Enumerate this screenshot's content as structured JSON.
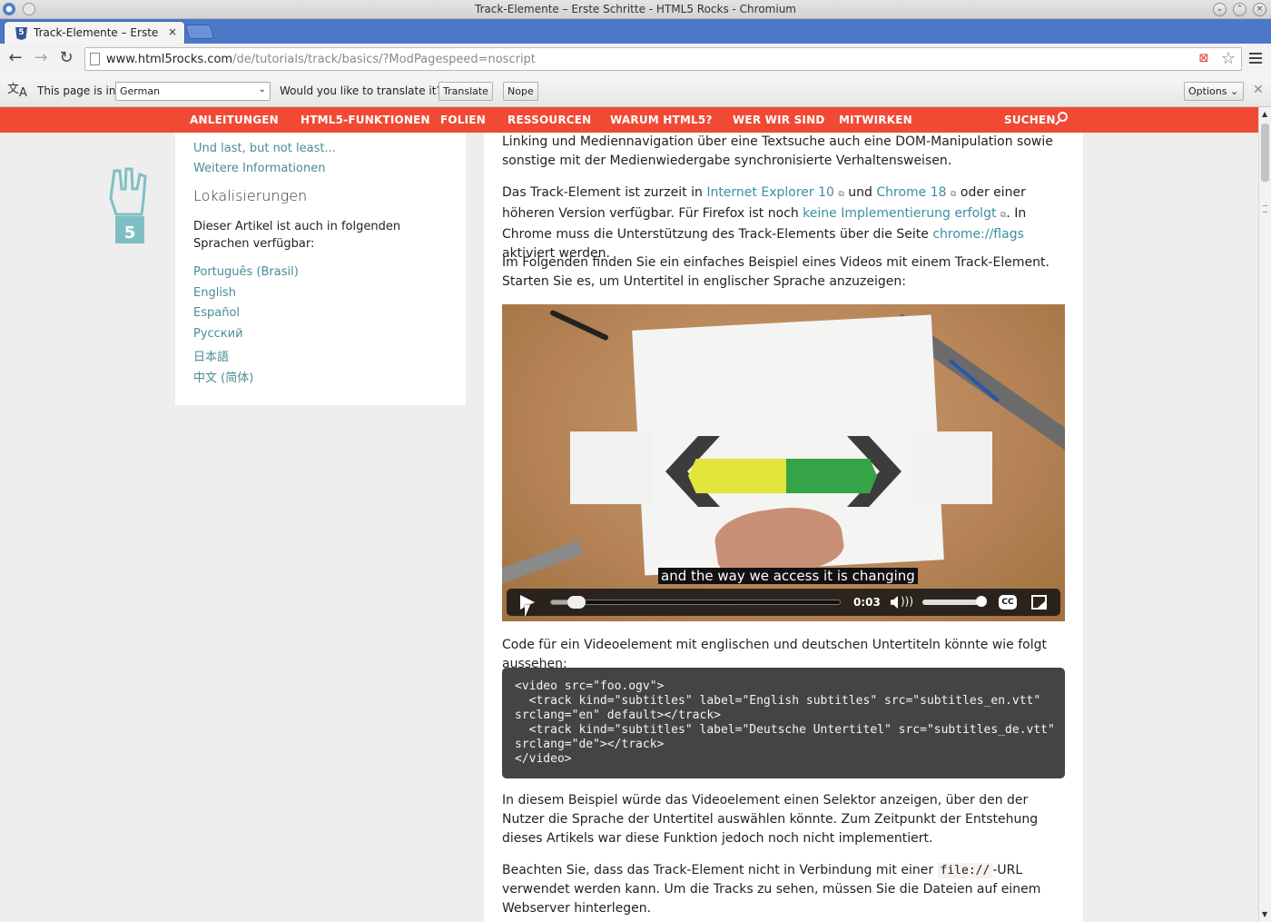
{
  "window": {
    "title": "Track-Elemente – Erste Schritte - HTML5 Rocks - Chromium"
  },
  "tab": {
    "title": "Track-Elemente – Erste Schritte - HTML5 Rocks",
    "close": "×"
  },
  "toolbar": {
    "url_host": "www.html5rocks.com",
    "url_path": "/de/tutorials/track/basics/?ModPagespeed=noscript"
  },
  "infobar": {
    "page_is_in": "This page is in",
    "language": "German",
    "question": "Would you like to translate it?",
    "translate": "Translate",
    "nope": "Nope",
    "options": "Options"
  },
  "nav": {
    "items": [
      "ANLEITUNGEN",
      "HTML5-FUNKTIONEN",
      "FOLIEN",
      "RESSOURCEN",
      "WARUM HTML5?",
      "WER WIR SIND",
      "MITWIRKEN"
    ],
    "search": "SUCHEN"
  },
  "sidebar": {
    "links_top": [
      "Und last, but not least...",
      "Weitere Informationen"
    ],
    "heading": "Lokalisierungen",
    "description": "Dieser Artikel ist auch in folgenden Sprachen verfügbar:",
    "languages": [
      "Português (Brasil)",
      "English",
      "Español",
      "Русский",
      "日本語",
      "中文 (简体)"
    ]
  },
  "article": {
    "p1": "Linking und Mediennavigation über eine Textsuche auch eine DOM-Manipulation sowie sonstige mit der Medienwiedergabe synchronisierte Verhaltensweisen.",
    "p2": {
      "t1": "Das Track-Element ist zurzeit in ",
      "link1": "Internet Explorer 10",
      "t2": " und ",
      "link2": "Chrome 18",
      "t3": " oder einer höheren Version verfügbar. Für Firefox ist noch ",
      "link3": "keine Implementierung erfolgt",
      "t4": ". In Chrome muss die Unterstützung des Track-Elements über die Seite ",
      "link4": "chrome://flags",
      "t5": " aktiviert werden."
    },
    "p3": "Im Folgenden finden Sie ein einfaches Beispiel eines Videos mit einem Track-Element. Starten Sie es, um Untertitel in englischer Sprache anzuzeigen:",
    "video": {
      "caption": "and the way we access it is changing",
      "time": "0:03",
      "progress": 0.07,
      "volume": 0.95,
      "cc": "CC"
    },
    "p4": "Code für ein Videoelement mit englischen und deutschen Untertiteln könnte wie folgt aussehen:",
    "code": [
      "<video src=\"foo.ogv\">",
      "  <track kind=\"subtitles\" label=\"English subtitles\" src=\"subtitles_en.vtt\"",
      "srclang=\"en\" default></track>",
      "  <track kind=\"subtitles\" label=\"Deutsche Untertitel\" src=\"subtitles_de.vtt\"",
      "srclang=\"de\"></track>",
      "</video>"
    ],
    "p5": "In diesem Beispiel würde das Videoelement einen Selektor anzeigen, über den der Nutzer die Sprache der Untertitel auswählen könnte. Zum Zeitpunkt der Entstehung dieses Artikels war diese Funktion jedoch noch nicht implementiert.",
    "p6": {
      "t1": "Beachten Sie, dass das Track-Element nicht in Verbindung mit einer ",
      "code": "file://",
      "t2": "-URL verwendet werden kann. Um die Tracks zu sehen, müssen Sie die Dateien auf einem Webserver hinterlegen."
    }
  },
  "colors": {
    "nav_bg": "#f04a34",
    "link": "#3b8fa0",
    "tabstrip": "#4d78c8"
  }
}
